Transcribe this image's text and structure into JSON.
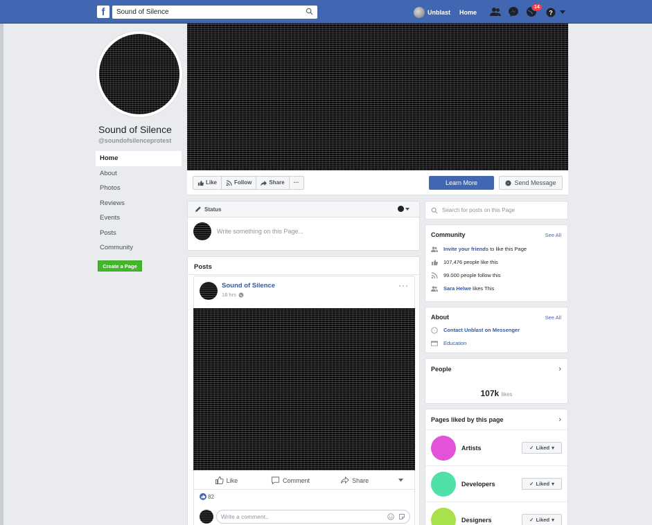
{
  "topbar": {
    "logo": "f",
    "search_value": "Sound of Silence",
    "user_name": "Unblast",
    "home_label": "Home",
    "notification_count": "14"
  },
  "page": {
    "name": "Sound of Silence",
    "handle": "@soundofsilenceprotest"
  },
  "leftnav": {
    "items": [
      {
        "label": "Home",
        "active": true
      },
      {
        "label": "About"
      },
      {
        "label": "Photos"
      },
      {
        "label": "Reviews"
      },
      {
        "label": "Events"
      },
      {
        "label": "Posts"
      },
      {
        "label": "Community"
      }
    ],
    "create_page": "Create a Page"
  },
  "actions": {
    "like": "Like",
    "follow": "Follow",
    "share": "Share",
    "more": "···",
    "learn_more": "Learn More",
    "send_message": "Send Message"
  },
  "status": {
    "label": "Status",
    "placeholder": "Write something on this Page..."
  },
  "posts": {
    "title": "Posts",
    "post": {
      "author": "Sound of Silence",
      "time": "18 hrs",
      "like_label": "Like",
      "comment_label": "Comment",
      "share_label": "Share",
      "reaction_count": "82",
      "comment_placeholder": "Write a comment.."
    }
  },
  "sidebar": {
    "search_placeholder": "Search for posts on this Page",
    "community": {
      "title": "Community",
      "see_all": "See All",
      "invite_link": "Invite your friends",
      "invite_rest": " to like this Page",
      "likes": "107,476 people like this",
      "follows": "99.000 people follow this",
      "friend_link": "Sara Helwe",
      "friend_rest": " likes This"
    },
    "about": {
      "title": "About",
      "see_all": "See All",
      "contact": "Contact Unblast on Messenger",
      "category": "Education"
    },
    "people": {
      "title": "People",
      "count": "107k",
      "unit": "likes"
    },
    "liked_pages": {
      "title": "Pages liked by this page",
      "button": "Liked",
      "items": [
        {
          "name": "Artists",
          "color": "#e353d8"
        },
        {
          "name": "Developers",
          "color": "#4fe0a8"
        },
        {
          "name": "Designers",
          "color": "#a8e24a"
        }
      ]
    }
  },
  "colors": {
    "brand": "#4267b2",
    "green": "#42b72a",
    "link": "#365899"
  }
}
